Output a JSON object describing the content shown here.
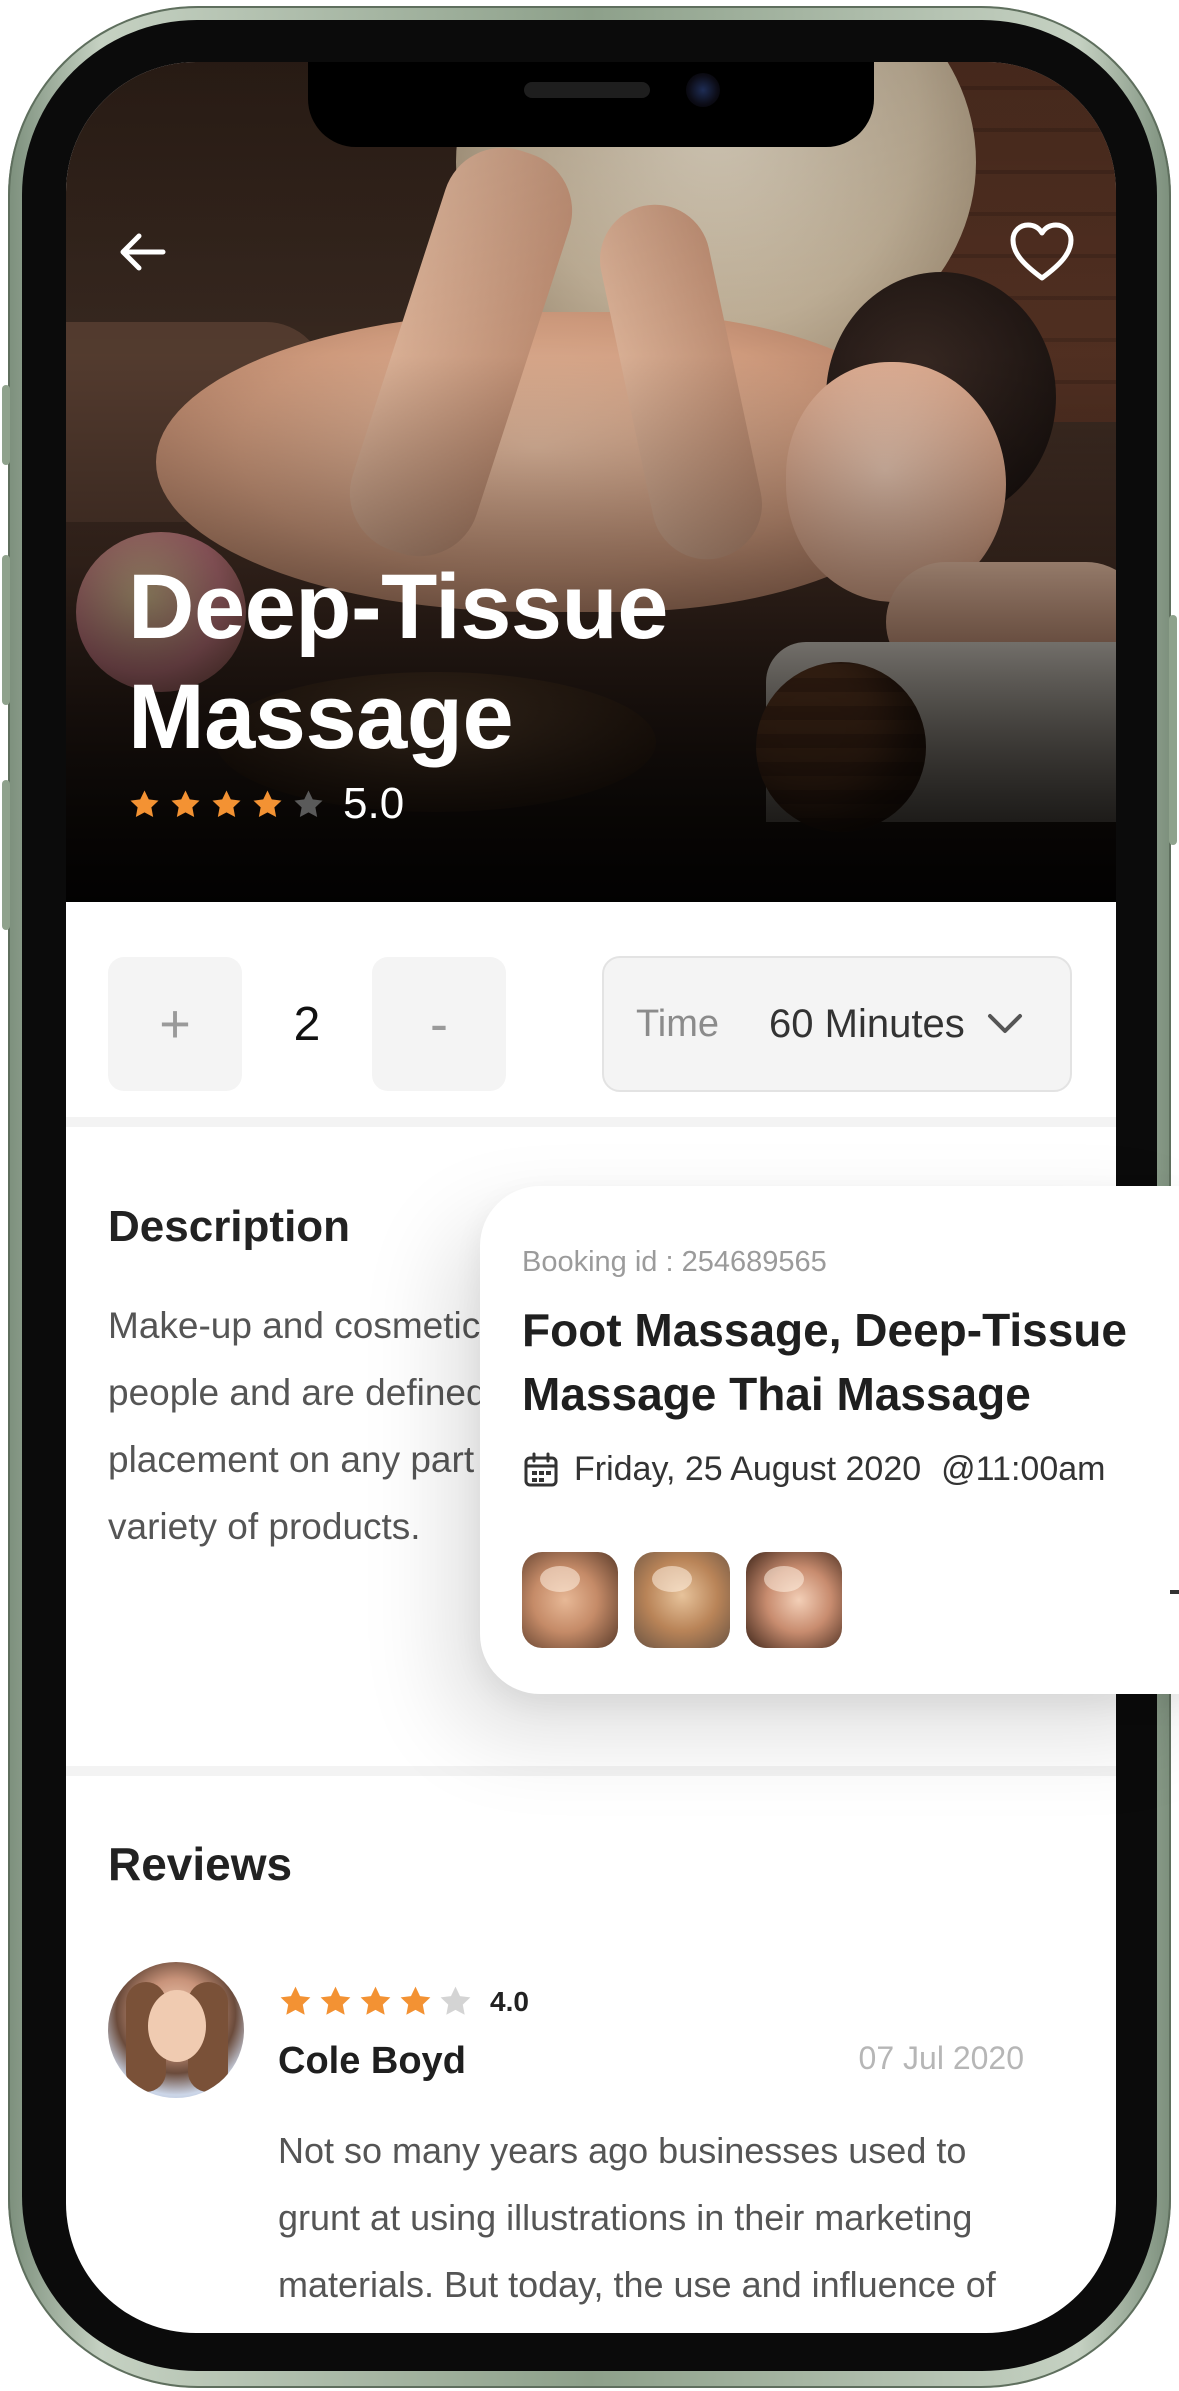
{
  "service": {
    "title": "Deep-Tissue Massage",
    "rating_value": "5.0",
    "rating_stars": 4
  },
  "booking_controls": {
    "plus_label": "+",
    "quantity": "2",
    "minus_label": "-",
    "time_label": "Time",
    "time_value": "60 Minutes"
  },
  "description": {
    "heading": "Description",
    "text": "Make-up and cosmetics are used by all kinds of different people and are defined as, “a substance intended for placement on any part of the human body; including a variety of products."
  },
  "booking_card": {
    "booking_id": "Booking id : 254689565",
    "services": "Foot Massage, Deep-Tissue Massage Thai Massage",
    "date": "Friday, 25 August 2020",
    "time": "@11:00am",
    "thumbnails": [
      "foot-massage-photo",
      "hair-styling-photo",
      "back-massage-photo"
    ]
  },
  "reviews": {
    "heading": "Reviews",
    "items": [
      {
        "rating": "4.0",
        "stars": 4,
        "name": "Cole Boyd",
        "date": "07 Jul 2020",
        "text": "Not so many years ago businesses used to grunt at using illustrations in their marketing materials. But today, the use and influence of"
      }
    ]
  },
  "colors": {
    "star_filled": "#f39233",
    "star_empty_dark": "#5a5a5a",
    "star_empty_light": "#d4d4d4"
  }
}
